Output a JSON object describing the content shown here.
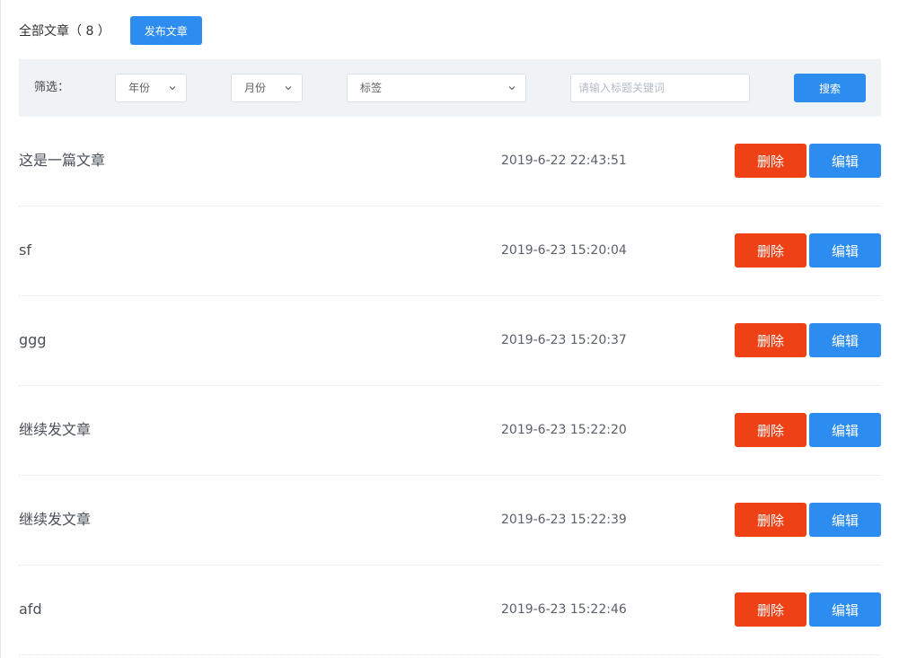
{
  "header": {
    "title": "全部文章（ 8 ）",
    "publish_label": "发布文章"
  },
  "filter": {
    "label": "筛选：",
    "year_label": "年份",
    "month_label": "月份",
    "tag_label": "标签",
    "search_placeholder": "请输入标题关键词",
    "search_label": "搜索"
  },
  "actions": {
    "delete_label": "删除",
    "edit_label": "编辑"
  },
  "articles": [
    {
      "title": "这是一篇文章",
      "date": "2019-6-22 22:43:51"
    },
    {
      "title": "sf",
      "date": "2019-6-23 15:20:04"
    },
    {
      "title": "ggg",
      "date": "2019-6-23 15:20:37"
    },
    {
      "title": "继续发文章",
      "date": "2019-6-23 15:22:20"
    },
    {
      "title": "继续发文章",
      "date": "2019-6-23 15:22:39"
    },
    {
      "title": "afd",
      "date": "2019-6-23 15:22:46"
    }
  ],
  "colors": {
    "primary": "#2d8cf0",
    "danger": "#ee4116",
    "filter_bg": "#f0f3f6"
  }
}
